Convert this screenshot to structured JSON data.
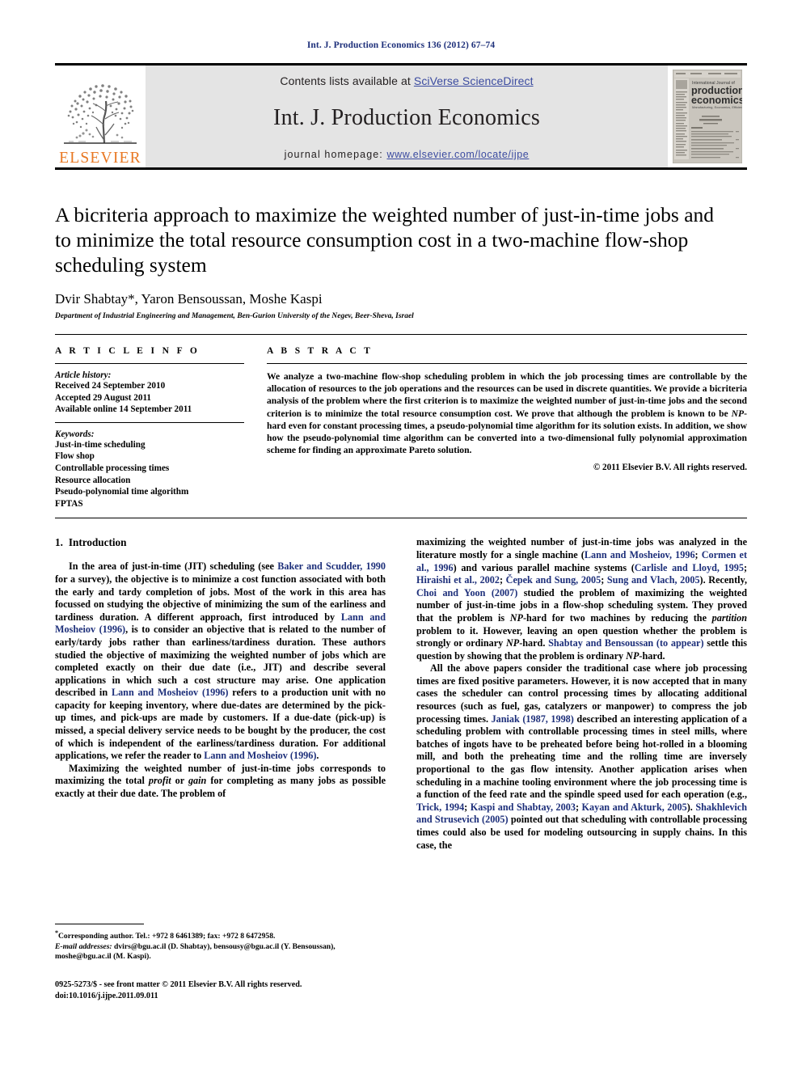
{
  "running_head": "Int. J. Production Economics 136 (2012) 67–74",
  "masthead": {
    "contents_prefix": "Contents lists available at ",
    "contents_link": "SciVerse ScienceDirect",
    "journal_title": "Int. J. Production Economics",
    "homepage_prefix": "journal homepage: ",
    "homepage_url": "www.elsevier.com/locate/ijpe",
    "publisher_wordmark": "ELSEVIER",
    "cover_title_line1": "International Journal of",
    "cover_title_line2": "production",
    "cover_title_line3": "economics",
    "cover_subtitle": "Manufacturing, Economics, Efficiency & Design",
    "accent_orange": "#e87722",
    "link_blue": "#3b4ba0",
    "band_gray": "#e4e4e4"
  },
  "article": {
    "title": "A bicriteria approach to maximize the weighted number of just-in-time jobs and to minimize the total resource consumption cost in a two-machine flow-shop scheduling system",
    "authors": "Dvir Shabtay*, Yaron Bensoussan, Moshe Kaspi",
    "affiliation": "Department of Industrial Engineering and Management, Ben-Gurion University of the Negev, Beer-Sheva, Israel"
  },
  "info": {
    "heading": "A R T I C L E   I N F O",
    "history_label": "Article history:",
    "history": [
      "Received 24 September 2010",
      "Accepted 29 August 2011",
      "Available online 14 September 2011"
    ],
    "keywords_label": "Keywords:",
    "keywords": [
      "Just-in-time scheduling",
      "Flow shop",
      "Controllable processing times",
      "Resource allocation",
      "Pseudo-polynomial time algorithm",
      "FPTAS"
    ]
  },
  "abstract": {
    "heading": "A B S T R A C T",
    "text_part1": "We analyze a two-machine flow-shop scheduling problem in which the job processing times are controllable by the allocation of resources to the job operations and the resources can be used in discrete quantities. We provide a bicriteria analysis of the problem where the first criterion is to maximize the weighted number of just-in-time jobs and the second criterion is to minimize the total resource consumption cost. We prove that although the problem is known to be ",
    "np_italic": "NP",
    "text_part2": "-hard even for constant processing times, a pseudo-polynomial time algorithm for its solution exists. In addition, we show how the pseudo-polynomial time algorithm can be converted into a two-dimensional fully polynomial approximation scheme for finding an approximate Pareto solution.",
    "copyright": "© 2011 Elsevier B.V. All rights reserved."
  },
  "body": {
    "section_number": "1.",
    "section_title": "Introduction",
    "left_paragraphs": [
      {
        "id": "p1",
        "segments": [
          {
            "t": "In the area of just-in-time (JIT) scheduling (see ",
            "k": "plain"
          },
          {
            "t": "Baker and Scudder, 1990",
            "k": "ref"
          },
          {
            "t": " for a survey), the objective is to minimize a cost function associated with both the early and tardy completion of jobs. Most of the work in this area has focussed on studying the objective of minimizing the sum of the earliness and tardiness duration. A different approach, first introduced by ",
            "k": "plain"
          },
          {
            "t": "Lann and Mosheiov (1996)",
            "k": "ref"
          },
          {
            "t": ", is to consider an objective that is related to the number of early/tardy jobs rather than earliness/tardiness duration. These authors studied the objective of maximizing the weighted number of jobs which are completed exactly on their due date (i.e., JIT) and describe several applications in which such a cost structure may arise. One application described in ",
            "k": "plain"
          },
          {
            "t": "Lann and Mosheiov (1996)",
            "k": "ref"
          },
          {
            "t": " refers to a production unit with no capacity for keeping inventory, where due-dates are determined by the pick-up times, and pick-ups are made by customers. If a due-date (pick-up) is missed, a special delivery service needs to be bought by the producer, the cost of which is independent of the earliness/tardiness duration. For additional applications, we refer the reader to ",
            "k": "plain"
          },
          {
            "t": "Lann and Mosheiov (1996)",
            "k": "ref"
          },
          {
            "t": ".",
            "k": "plain"
          }
        ]
      },
      {
        "id": "p2",
        "segments": [
          {
            "t": "Maximizing the weighted number of just-in-time jobs corresponds to maximizing the total ",
            "k": "plain"
          },
          {
            "t": "profit",
            "k": "ital"
          },
          {
            "t": " or ",
            "k": "plain"
          },
          {
            "t": "gain",
            "k": "ital"
          },
          {
            "t": " for completing as many jobs as possible exactly at their due date. The problem of",
            "k": "plain"
          }
        ]
      }
    ],
    "right_paragraphs": [
      {
        "id": "p3",
        "segments": [
          {
            "t": "maximizing the weighted number of just-in-time jobs was analyzed in the literature mostly for a single machine (",
            "k": "plain"
          },
          {
            "t": "Lann and Mosheiov, 1996",
            "k": "ref"
          },
          {
            "t": "; ",
            "k": "plain"
          },
          {
            "t": "Cormen et al., 1996",
            "k": "ref"
          },
          {
            "t": ") and various parallel machine systems (",
            "k": "plain"
          },
          {
            "t": "Carlisle and Lloyd, 1995",
            "k": "ref"
          },
          {
            "t": "; ",
            "k": "plain"
          },
          {
            "t": "Hiraishi et al., 2002",
            "k": "ref"
          },
          {
            "t": "; ",
            "k": "plain"
          },
          {
            "t": "Čepek and Sung, 2005",
            "k": "ref"
          },
          {
            "t": "; ",
            "k": "plain"
          },
          {
            "t": "Sung and Vlach, 2005",
            "k": "ref"
          },
          {
            "t": "). Recently, ",
            "k": "plain"
          },
          {
            "t": "Choi and Yoon (2007)",
            "k": "ref"
          },
          {
            "t": " studied the problem of maximizing the weighted number of just-in-time jobs in a flow-shop scheduling system. They proved that the problem is ",
            "k": "plain"
          },
          {
            "t": "NP",
            "k": "ital"
          },
          {
            "t": "-hard for two machines by reducing the ",
            "k": "plain"
          },
          {
            "t": "partition",
            "k": "ital"
          },
          {
            "t": " problem to it. However, leaving an open question whether the problem is strongly or ordinary ",
            "k": "plain"
          },
          {
            "t": "NP",
            "k": "ital"
          },
          {
            "t": "-hard. ",
            "k": "plain"
          },
          {
            "t": "Shabtay and Bensoussan (to appear)",
            "k": "ref"
          },
          {
            "t": " settle this question by showing that the problem is ordinary ",
            "k": "plain"
          },
          {
            "t": "NP",
            "k": "ital"
          },
          {
            "t": "-hard.",
            "k": "plain"
          }
        ]
      },
      {
        "id": "p4",
        "segments": [
          {
            "t": "All the above papers consider the traditional case where job processing times are fixed positive parameters. However, it is now accepted that in many cases the scheduler can control processing times by allocating additional resources (such as fuel, gas, catalyzers or manpower) to compress the job processing times. ",
            "k": "plain"
          },
          {
            "t": "Janiak (1987, 1998)",
            "k": "ref"
          },
          {
            "t": " described an interesting application of a scheduling problem with controllable processing times in steel mills, where batches of ingots have to be preheated before being hot-rolled in a blooming mill, and both the preheating time and the rolling time are inversely proportional to the gas flow intensity. Another application arises when scheduling in a machine tooling environment where the job processing time is a function of the feed rate and the spindle speed used for each operation (e.g., ",
            "k": "plain"
          },
          {
            "t": "Trick, 1994",
            "k": "ref"
          },
          {
            "t": "; ",
            "k": "plain"
          },
          {
            "t": "Kaspi and Shabtay, 2003",
            "k": "ref"
          },
          {
            "t": "; ",
            "k": "plain"
          },
          {
            "t": "Kayan and Akturk, 2005",
            "k": "ref"
          },
          {
            "t": "). ",
            "k": "plain"
          },
          {
            "t": "Shakhlevich and Strusevich (2005)",
            "k": "ref"
          },
          {
            "t": " pointed out that scheduling with controllable processing times could also be used for modeling outsourcing in supply chains. In this case, the",
            "k": "plain"
          }
        ]
      }
    ]
  },
  "footnote": {
    "corresponding_marker": "*",
    "corresponding_text": "Corresponding author. Tel.: +972 8 6461389; fax: +972 8 6472958.",
    "email_label": "E-mail addresses:",
    "email_text": " dvirs@bgu.ac.il (D. Shabtay), bensousy@bgu.ac.il (Y. Bensoussan), moshe@bgu.ac.il (M. Kaspi).",
    "issn_line": "0925-5273/$ - see front matter © 2011 Elsevier B.V. All rights reserved.",
    "doi_line": "doi:10.1016/j.ijpe.2011.09.011"
  }
}
